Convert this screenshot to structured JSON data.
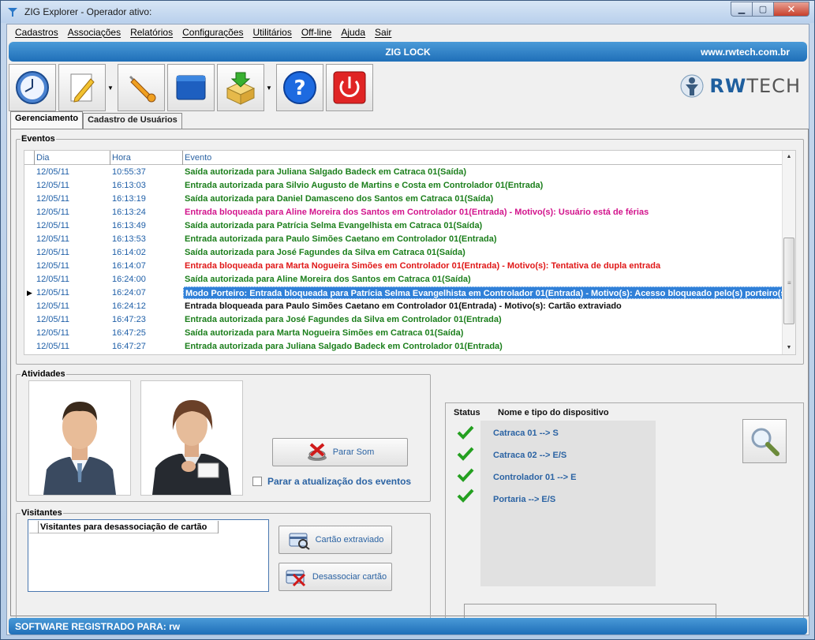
{
  "window": {
    "title": "ZIG Explorer - Operador ativo:"
  },
  "menu": [
    "Cadastros",
    "Associações",
    "Relatórios",
    "Configurações",
    "Utilitários",
    "Off-line",
    "Ajuda",
    "Sair"
  ],
  "banner": {
    "center": "ZIG LOCK",
    "right": "www.rwtech.com.br"
  },
  "logo": {
    "part1": "RW",
    "part2": "TECH"
  },
  "tabs": {
    "gerenciamento": "Gerenciamento",
    "cadastro": "Cadastro de Usuários"
  },
  "eventos": {
    "legend": "Eventos",
    "columns": {
      "dia": "Dia",
      "hora": "Hora",
      "evento": "Evento"
    },
    "rows": [
      {
        "dia": "12/05/11",
        "hora": "10:55:37",
        "evento": "Saída autorizada para Juliana Salgado Badeck em Catraca 01(Saída)",
        "color": "#1c7f1c"
      },
      {
        "dia": "12/05/11",
        "hora": "16:13:03",
        "evento": "Entrada autorizada para Silvio Augusto de Martins e Costa em Controlador 01(Entrada)",
        "color": "#1c7f1c"
      },
      {
        "dia": "12/05/11",
        "hora": "16:13:19",
        "evento": "Saída autorizada para Daniel Damasceno dos Santos em Catraca 01(Saída)",
        "color": "#1c7f1c"
      },
      {
        "dia": "12/05/11",
        "hora": "16:13:24",
        "evento": "Entrada bloqueada para Aline Moreira dos Santos em Controlador 01(Entrada) - Motivo(s): Usuário está de férias",
        "color": "#d2148c"
      },
      {
        "dia": "12/05/11",
        "hora": "16:13:49",
        "evento": "Saída autorizada para Patrícia Selma Evangelhista em Catraca 01(Saída)",
        "color": "#1c7f1c"
      },
      {
        "dia": "12/05/11",
        "hora": "16:13:53",
        "evento": "Entrada autorizada para Paulo Simões Caetano em Controlador 01(Entrada)",
        "color": "#1c7f1c"
      },
      {
        "dia": "12/05/11",
        "hora": "16:14:02",
        "evento": "Saída autorizada para José Fagundes da Silva em Catraca 01(Saída)",
        "color": "#1c7f1c"
      },
      {
        "dia": "12/05/11",
        "hora": "16:14:07",
        "evento": "Entrada bloqueada para Marta Nogueira Simões  em Controlador 01(Entrada) - Motivo(s): Tentativa de dupla entrada",
        "color": "#e01818"
      },
      {
        "dia": "12/05/11",
        "hora": "16:24:00",
        "evento": "Saída autorizada para Aline Moreira dos Santos em Catraca 01(Saída)",
        "color": "#1c7f1c"
      },
      {
        "dia": "12/05/11",
        "hora": "16:24:07",
        "evento": "Modo Porteiro: Entrada bloqueada para Patrícia Selma Evangelhista em Controlador 01(Entrada) - Motivo(s): Acesso bloqueado pelo(s) porteiro(s)",
        "color": "#ffffff",
        "selected": true
      },
      {
        "dia": "12/05/11",
        "hora": "16:24:12",
        "evento": "Entrada bloqueada para Paulo Simões Caetano em Controlador 01(Entrada) - Motivo(s): Cartão extraviado",
        "color": "#111111"
      },
      {
        "dia": "12/05/11",
        "hora": "16:47:23",
        "evento": "Entrada autorizada para José Fagundes da Silva em Controlador 01(Entrada)",
        "color": "#1c7f1c"
      },
      {
        "dia": "12/05/11",
        "hora": "16:47:25",
        "evento": "Saída autorizada para Marta Nogueira Simões  em Catraca 01(Saída)",
        "color": "#1c7f1c"
      },
      {
        "dia": "12/05/11",
        "hora": "16:47:27",
        "evento": "Entrada autorizada para Juliana Salgado Badeck em Controlador 01(Entrada)",
        "color": "#1c7f1c"
      }
    ]
  },
  "atividades": {
    "legend": "Atividades",
    "parar_som": "Parar Som",
    "parar_atualizacao": "Parar a atualização dos eventos"
  },
  "visitantes": {
    "legend": "Visitantes",
    "list_header": "Visitantes para desassociação de cartão",
    "cartao_extraviado": "Cartão extraviado",
    "desassociar": "Desassociar cartão"
  },
  "status": {
    "col_status": "Status",
    "col_nome": "Nome e tipo do dispositivo",
    "devices": [
      "Catraca 01 --> S",
      "Catraca 02 --> E/S",
      "Controlador 01 --> E",
      "Portaria --> E/S"
    ]
  },
  "footer": {
    "text": "SOFTWARE REGISTRADO PARA: rw"
  }
}
